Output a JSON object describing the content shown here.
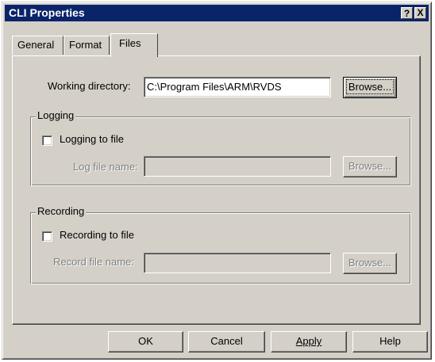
{
  "window": {
    "title": "CLI Properties",
    "help_glyph": "?",
    "close_glyph": "X"
  },
  "tabs": [
    {
      "label": "General"
    },
    {
      "label": "Format"
    },
    {
      "label": "Files"
    }
  ],
  "working_dir": {
    "label": "Working directory:",
    "value": "C:\\Program Files\\ARM\\RVDS",
    "browse_label": "Browse..."
  },
  "logging": {
    "group_title": "Logging",
    "checkbox_label": "Logging to file",
    "checked": false,
    "file_label": "Log file name:",
    "file_value": "",
    "browse_label": "Browse..."
  },
  "recording": {
    "group_title": "Recording",
    "checkbox_label": "Recording to file",
    "checked": false,
    "file_label": "Record file name:",
    "file_value": "",
    "browse_label": "Browse..."
  },
  "buttons": {
    "ok": "OK",
    "cancel": "Cancel",
    "apply": "Apply",
    "help": "Help"
  }
}
